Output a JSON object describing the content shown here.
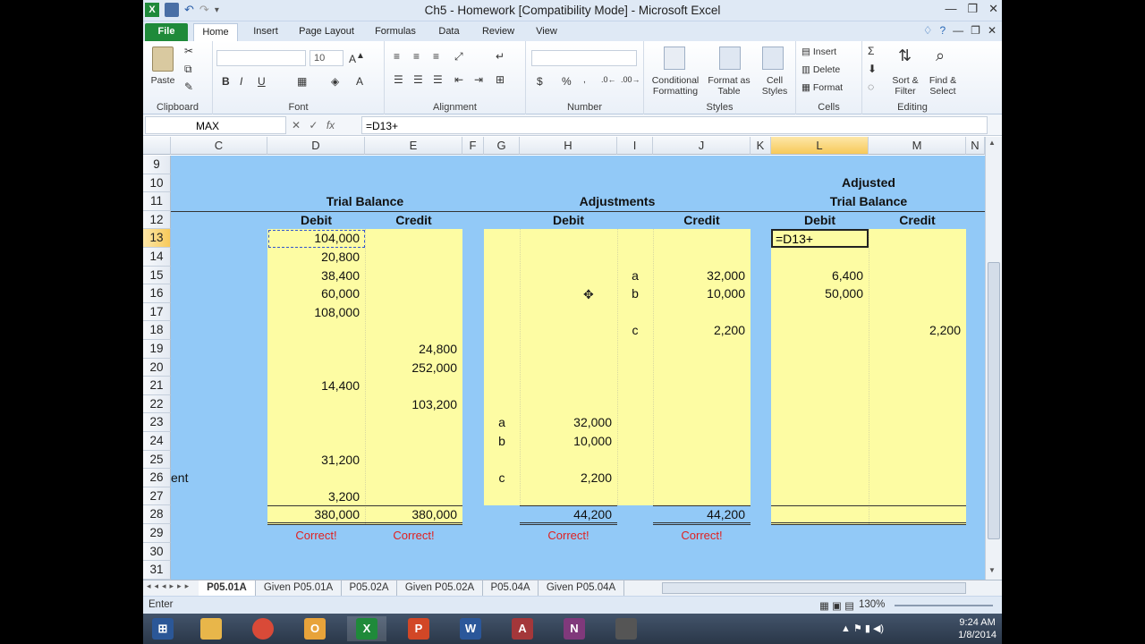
{
  "window": {
    "title": "Ch5 - Homework  [Compatibility Mode] - Microsoft Excel",
    "controls": [
      "—",
      "❐",
      "✕"
    ]
  },
  "ribbon_tabs": [
    "File",
    "Home",
    "Insert",
    "Page Layout",
    "Formulas",
    "Data",
    "Review",
    "View"
  ],
  "active_tab": "Home",
  "ribbon": {
    "clipboard": {
      "paste": "Paste",
      "label": "Clipboard"
    },
    "font": {
      "name": "",
      "size": "10",
      "label": "Font",
      "bold": "B",
      "italic": "I",
      "underline": "U"
    },
    "alignment": {
      "label": "Alignment"
    },
    "number": {
      "format": "",
      "label": "Number",
      "currency": "$",
      "percent": "%"
    },
    "styles": {
      "conditional": "Conditional Formatting",
      "format_table": "Format as Table",
      "cell_styles": "Cell Styles",
      "label": "Styles"
    },
    "cells": {
      "insert": "Insert",
      "delete": "Delete",
      "format": "Format",
      "label": "Cells"
    },
    "editing": {
      "sort": "Sort & Filter",
      "find": "Find & Select",
      "label": "Editing"
    }
  },
  "formula_bar": {
    "name_box": "MAX",
    "fx": "fx",
    "formula": "=D13+"
  },
  "columns": [
    "C",
    "D",
    "E",
    "F",
    "G",
    "H",
    "I",
    "J",
    "K",
    "L",
    "M",
    "N"
  ],
  "selected_column": "L",
  "rows": [
    "9",
    "10",
    "11",
    "12",
    "13",
    "14",
    "15",
    "16",
    "17",
    "18",
    "19",
    "20",
    "21",
    "22",
    "23",
    "24",
    "25",
    "26",
    "27",
    "28",
    "29",
    "30",
    "31"
  ],
  "selected_row": "13",
  "headings": {
    "trial_balance": "Trial Balance",
    "adjustments": "Adjustments",
    "adjusted": "Adjusted",
    "adjusted_trial_balance": "Trial Balance",
    "debit": "Debit",
    "credit": "Credit"
  },
  "trial_balance": {
    "debit": [
      "104,000",
      "20,800",
      "38,400",
      "60,000",
      "108,000",
      "",
      "",
      "14,400",
      "",
      "",
      "",
      "31,200",
      "",
      "3,200"
    ],
    "credit": [
      "",
      "",
      "",
      "",
      "",
      "",
      "24,800",
      "252,000",
      "",
      "103,200",
      "",
      "",
      "",
      ""
    ],
    "total_debit": "380,000",
    "total_credit": "380,000",
    "check_debit": "Correct!",
    "check_credit": "Correct!"
  },
  "adjustments": {
    "debit_entries": [
      {
        "row": "23",
        "code": "a",
        "amount": "32,000"
      },
      {
        "row": "24",
        "code": "b",
        "amount": "10,000"
      },
      {
        "row": "26",
        "code": "c",
        "amount": "2,200"
      }
    ],
    "credit_entries": [
      {
        "row": "15",
        "code": "a",
        "amount": "32,000"
      },
      {
        "row": "16",
        "code": "b",
        "amount": "10,000"
      },
      {
        "row": "18",
        "code": "c",
        "amount": "2,200"
      }
    ],
    "total_debit": "44,200",
    "total_credit": "44,200",
    "check_debit": "Correct!",
    "check_credit": "Correct!"
  },
  "adjusted_tb": {
    "editing_cell": "=D13+",
    "l15": "6,400",
    "l16": "50,000",
    "m18": "2,200"
  },
  "c26_text": "ent",
  "sheet_tabs": [
    "P05.01A",
    "Given P05.01A",
    "P05.02A",
    "Given P05.02A",
    "P05.04A",
    "Given P05.04A"
  ],
  "active_sheet": "P05.01A",
  "status": {
    "mode": "Enter",
    "zoom": "130%"
  },
  "taskbar": {
    "time": "9:24 AM",
    "date": "1/8/2014",
    "apps": [
      "start-button",
      "file-explorer",
      "chrome",
      "outlook",
      "excel",
      "powerpoint",
      "word",
      "access",
      "onenote",
      "other-app"
    ]
  },
  "colors": {
    "sheet_bg": "#92c9f7",
    "input_bg": "#fdfca3",
    "correct": "#e02020",
    "file_tab": "#1f8a3a"
  }
}
